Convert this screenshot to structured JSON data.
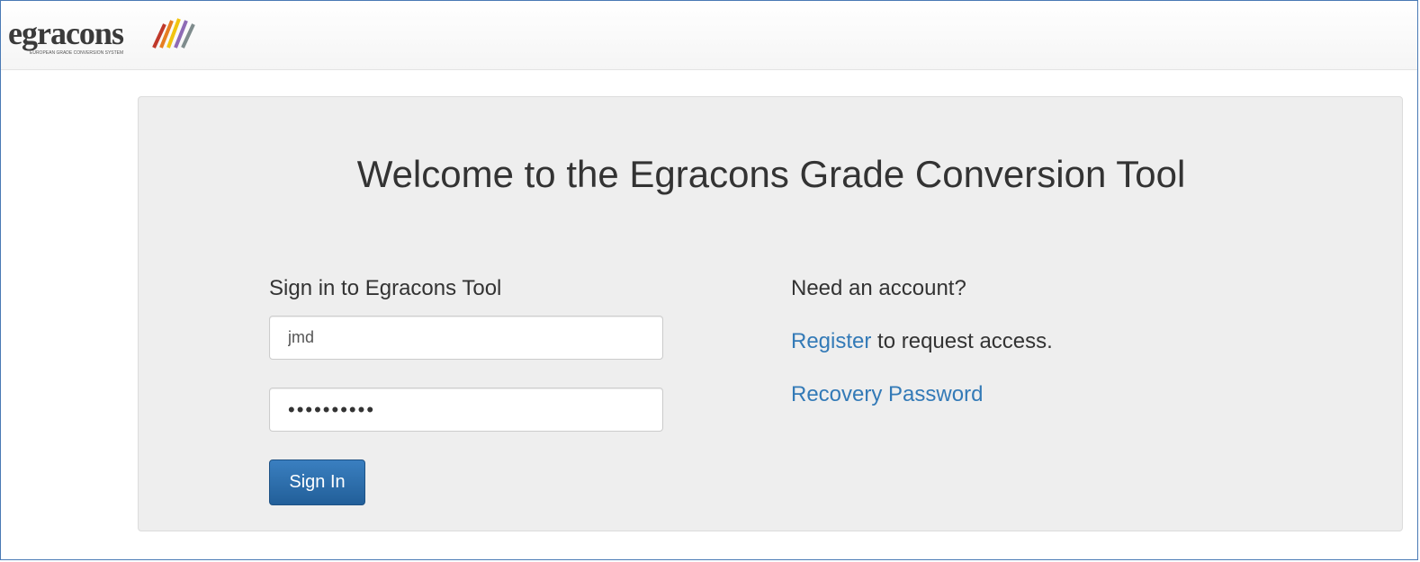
{
  "app": {
    "logo_text": "egracons",
    "logo_tagline": "EUROPEAN GRADE CONVERSION SYSTEM",
    "logo_colors": [
      "#c0392b",
      "#e67e22",
      "#f1c40f",
      "#8e6bb5",
      "#7f8c8d"
    ]
  },
  "jumbotron": {
    "title": "Welcome to the Egracons Grade Conversion Tool"
  },
  "signin": {
    "heading": "Sign in to Egracons Tool",
    "username_value": "jmd",
    "password_value": "••••••••••",
    "button_label": "Sign In"
  },
  "account": {
    "heading": "Need an account?",
    "register_link": "Register",
    "register_suffix": " to request access.",
    "recovery_link": "Recovery Password"
  },
  "colors": {
    "link": "#337ab7",
    "button": "#286090",
    "panel_bg": "#eeeeee"
  }
}
